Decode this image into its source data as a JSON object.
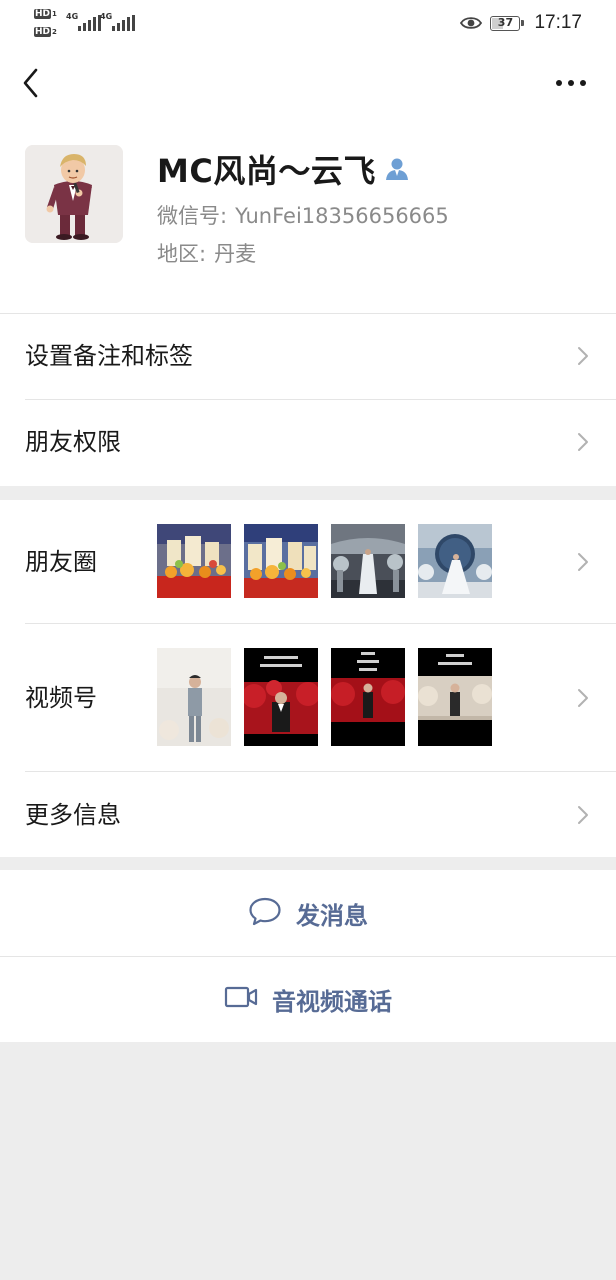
{
  "status_bar": {
    "sim1_badge": "HD",
    "sim1_slot": "1",
    "sim2_badge": "HD",
    "sim2_slot": "2",
    "net1": "4G",
    "net2": "4G",
    "battery_level": "37",
    "time": "17:17"
  },
  "nav": {
    "back_icon": "chevron-left-icon",
    "more_icon": "more-dots-icon"
  },
  "profile": {
    "name": "MC风尚～云飞",
    "wechat_id_label": "微信号:",
    "wechat_id": "YunFei18356656665",
    "region_label": "地区:",
    "region": "丹麦",
    "contact_icon": "contact-person-icon",
    "contact_icon_color": "#6e9fd4"
  },
  "menu": {
    "remark_tags": "设置备注和标签",
    "friend_permissions": "朋友权限",
    "moments": "朋友圈",
    "channels": "视频号",
    "more_info": "更多信息"
  },
  "moments_thumbs": [
    "party-food-photo",
    "party-food-photo",
    "wedding-stage-photo",
    "wedding-bride-photo"
  ],
  "channels_thumbs": [
    "host-on-stage-video",
    "host-red-stage-video",
    "host-red-stage-video",
    "host-wedding-stage-video"
  ],
  "actions": {
    "send_message": "发消息",
    "send_message_icon": "chat-bubble-icon",
    "video_call": "音视频通话",
    "video_call_icon": "video-camera-icon",
    "accent_color": "#576b95"
  }
}
